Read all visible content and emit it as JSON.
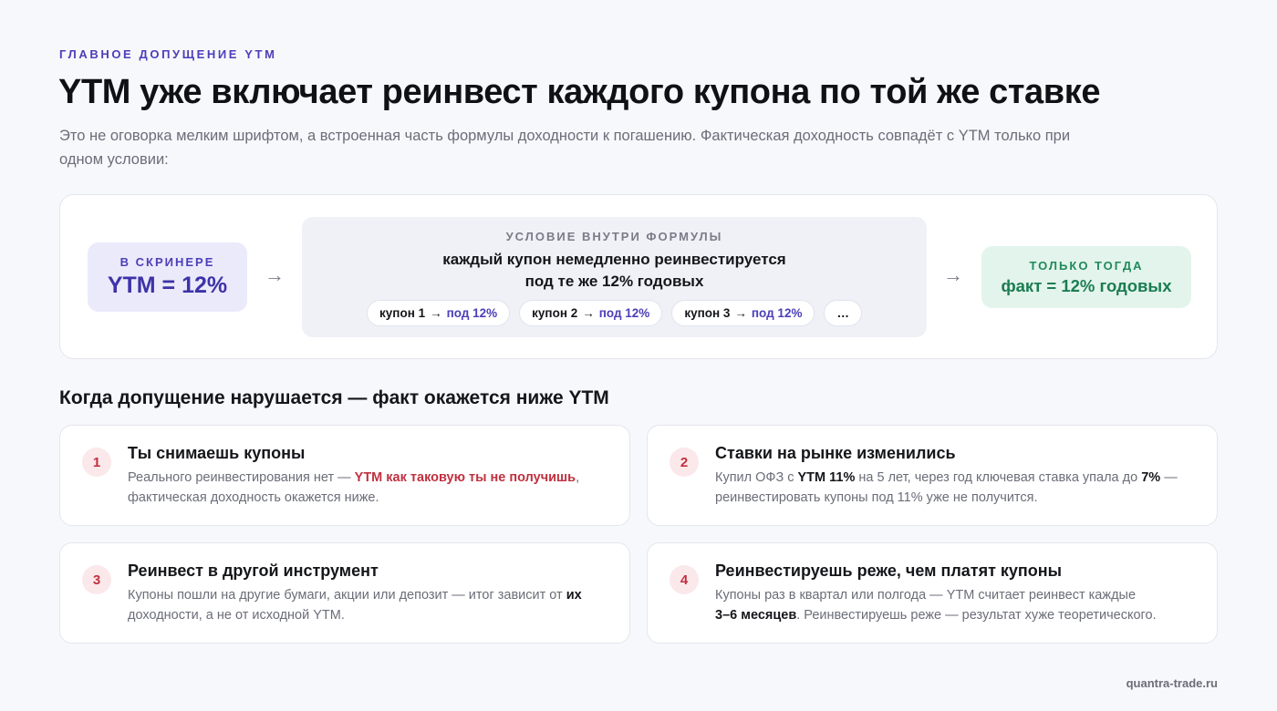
{
  "eyebrow": "ГЛАВНОЕ ДОПУЩЕНИЕ YTM",
  "title": "YTM уже включает реинвест каждого купона по той же ставке",
  "subtitle": "Это не оговорка мелким шрифтом, а встроенная часть формулы доходности к погашению. Фактическая доходность совпадёт с YTM только при одном условии:",
  "flow": {
    "left": {
      "label": "В СКРИНЕРЕ",
      "value": "YTM = 12%"
    },
    "arrow": "→",
    "condition": {
      "label": "УСЛОВИЕ ВНУТРИ ФОРМУЛЫ",
      "line1": "каждый купон немедленно реинвестируется",
      "line2": "под те же 12% годовых",
      "chips": [
        {
          "coupon": "купон 1",
          "arrow": "→",
          "rate": "под 12%"
        },
        {
          "coupon": "купон 2",
          "arrow": "→",
          "rate": "под 12%"
        },
        {
          "coupon": "купон 3",
          "arrow": "→",
          "rate": "под 12%"
        }
      ],
      "more": "…"
    },
    "right": {
      "label": "ТОЛЬКО ТОГДА",
      "value": "факт = 12% годовых"
    }
  },
  "section_title": "Когда допущение нарушается — факт окажется ниже YTM",
  "cards": [
    {
      "num": "1",
      "title": "Ты снимаешь купоны",
      "d1": "Реального реинвестирования нет — ",
      "d2": "YTM как таковую ты не получишь",
      "d3": ",",
      "d4": "фактическая доходность окажется ниже."
    },
    {
      "num": "2",
      "title": "Ставки на рынке изменились",
      "d1": "Купил ОФЗ с ",
      "d2": "YTM 11%",
      "d3": " на 5 лет, через год ключевая ставка упала до ",
      "d4": "7%",
      "d5": " —",
      "d6": "реинвестировать купоны под 11% уже не получится."
    },
    {
      "num": "3",
      "title": "Реинвест в другой инструмент",
      "d1": "Купоны пошли на другие бумаги, акции или депозит — итог зависит от ",
      "d2": "их",
      "d3": "доходности, а не от исходной YTM."
    },
    {
      "num": "4",
      "title": "Реинвестируешь реже, чем платят купоны",
      "d1": "Купоны раз в квартал или полгода — YTM считает реинвест каждые",
      "d2": "3–6 месяцев",
      "d3": ". Реинвестируешь реже — результат хуже теоретического."
    }
  ],
  "footer": "quantra-trade.ru",
  "colors": {
    "accent": "#4b3fb8",
    "green": "#1b7d51",
    "red": "#c0303f",
    "background": "#f7f8fc"
  }
}
